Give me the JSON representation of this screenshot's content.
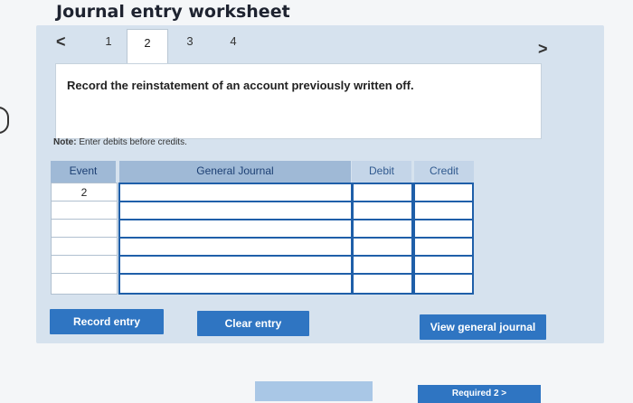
{
  "worksheet": {
    "title": "Journal entry worksheet",
    "tabs": [
      "1",
      "2",
      "3",
      "4"
    ],
    "active_tab": "2",
    "nav_prev": "<",
    "nav_next": ">",
    "description": "Record the reinstatement of an account previously written off.",
    "note_label": "Note:",
    "note_text": "Enter debits before credits."
  },
  "table": {
    "headers": {
      "event": "Event",
      "general_journal": "General Journal",
      "debit": "Debit",
      "credit": "Credit"
    },
    "rows": [
      {
        "event": "2",
        "general_journal": "",
        "debit": "",
        "credit": ""
      },
      {
        "event": "",
        "general_journal": "",
        "debit": "",
        "credit": ""
      },
      {
        "event": "",
        "general_journal": "",
        "debit": "",
        "credit": ""
      },
      {
        "event": "",
        "general_journal": "",
        "debit": "",
        "credit": ""
      },
      {
        "event": "",
        "general_journal": "",
        "debit": "",
        "credit": ""
      },
      {
        "event": "",
        "general_journal": "",
        "debit": "",
        "credit": ""
      }
    ]
  },
  "buttons": {
    "record_entry": "Record entry",
    "clear_entry": "Clear entry",
    "view_general_journal": "View general journal",
    "required_next": "Required 2 >"
  }
}
